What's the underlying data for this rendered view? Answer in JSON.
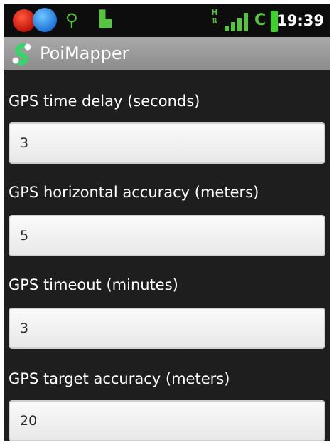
{
  "status_bar": {
    "time": "19:39",
    "data_indicator": "H",
    "carrier_indicator": "C",
    "icons": [
      "app-notification-icon",
      "wifi-icon",
      "usb-icon",
      "android-icon",
      "data-h-icon",
      "signal-bars-icon",
      "battery-icon"
    ]
  },
  "app": {
    "title": "PoiMapper",
    "logo_color": "#37d46a"
  },
  "settings": [
    {
      "label": "GPS time delay (seconds)",
      "value": "3"
    },
    {
      "label": "GPS horizontal accuracy (meters)",
      "value": "5"
    },
    {
      "label": "GPS timeout (minutes)",
      "value": "3"
    },
    {
      "label": "GPS target accuracy (meters)",
      "value": "20"
    }
  ]
}
